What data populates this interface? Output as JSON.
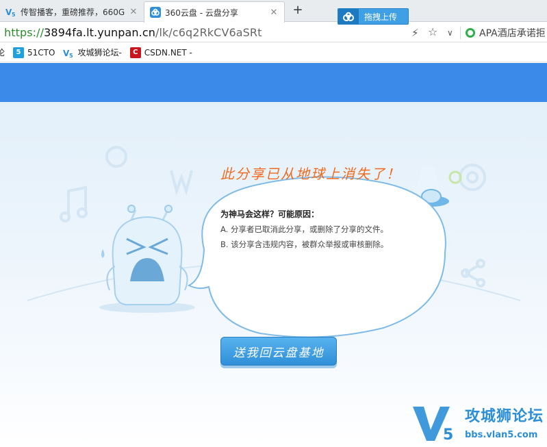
{
  "tabs": [
    {
      "title": "传智播客，重磅推荐，660G",
      "active": false,
      "icon": "v5-favicon"
    },
    {
      "title": "360云盘 - 云盘分享",
      "active": true,
      "icon": "cloud-favicon"
    }
  ],
  "drag_upload_label": "拖拽上传",
  "address": {
    "scheme": "https://",
    "host": "3894fa.lt.yunpan.cn",
    "path": "/lk/c6q2RkCV6aSRt"
  },
  "search_hint": "APA酒店承诺拒",
  "bookmarks": [
    {
      "label": "",
      "icon": "partial-favicon"
    },
    {
      "label": "51CTO",
      "icon": "51cto-favicon"
    },
    {
      "label": "攻城狮论坛-",
      "icon": "v5-favicon"
    },
    {
      "label": "CSDN.NET -",
      "icon": "csdn-favicon"
    }
  ],
  "partial_bookmark_glyph": "论",
  "bubble": {
    "title": "此分享已从地球上消失了！",
    "question": "为神马会这样？可能原因：",
    "reasons": [
      "A. 分享者已取消此分享，或删除了分享的文件。",
      "B. 该分享含违规内容，被群众举报或审核删除。"
    ]
  },
  "home_button_label": "送我回云盘基地",
  "watermark": {
    "title": "攻城狮论坛",
    "url": "bbs.vlan5.com",
    "logo_text": "V5"
  },
  "colors": {
    "header_blue": "#3b89e8",
    "title_orange": "#f06a1e",
    "button_blue": "#3a9ae2",
    "url_green": "#2c8c2c"
  }
}
